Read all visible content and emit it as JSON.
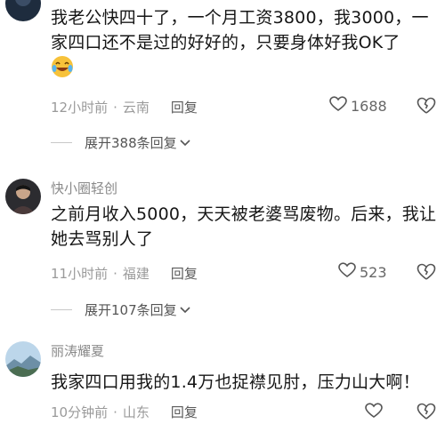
{
  "comments": [
    {
      "text": "我老公快四十了，一个月工资3800，我3000，一家四口还不是过的好好的，只要身体好我OK了",
      "time": "12小时前",
      "location": "云南",
      "reply_label": "回复",
      "likes": "1688",
      "expand_label": "展开388条回复"
    },
    {
      "username": "快小圈轻创",
      "text": "之前月收入5000，天天被老婆骂废物。后来，我让她去骂别人了",
      "time": "11小时前",
      "location": "福建",
      "reply_label": "回复",
      "likes": "523",
      "expand_label": "展开107条回复"
    },
    {
      "username": "丽涛耀夏",
      "text": "我家四口用我的1.4万也捉襟见肘，压力山大啊！",
      "time": "10分钟前",
      "location": "山东",
      "reply_label": "回复"
    }
  ],
  "icons": {
    "emoji": "laughing-tears-emoji",
    "like": "heart-icon",
    "dislike": "broken-heart-icon",
    "expand": "chevron-down-icon"
  }
}
